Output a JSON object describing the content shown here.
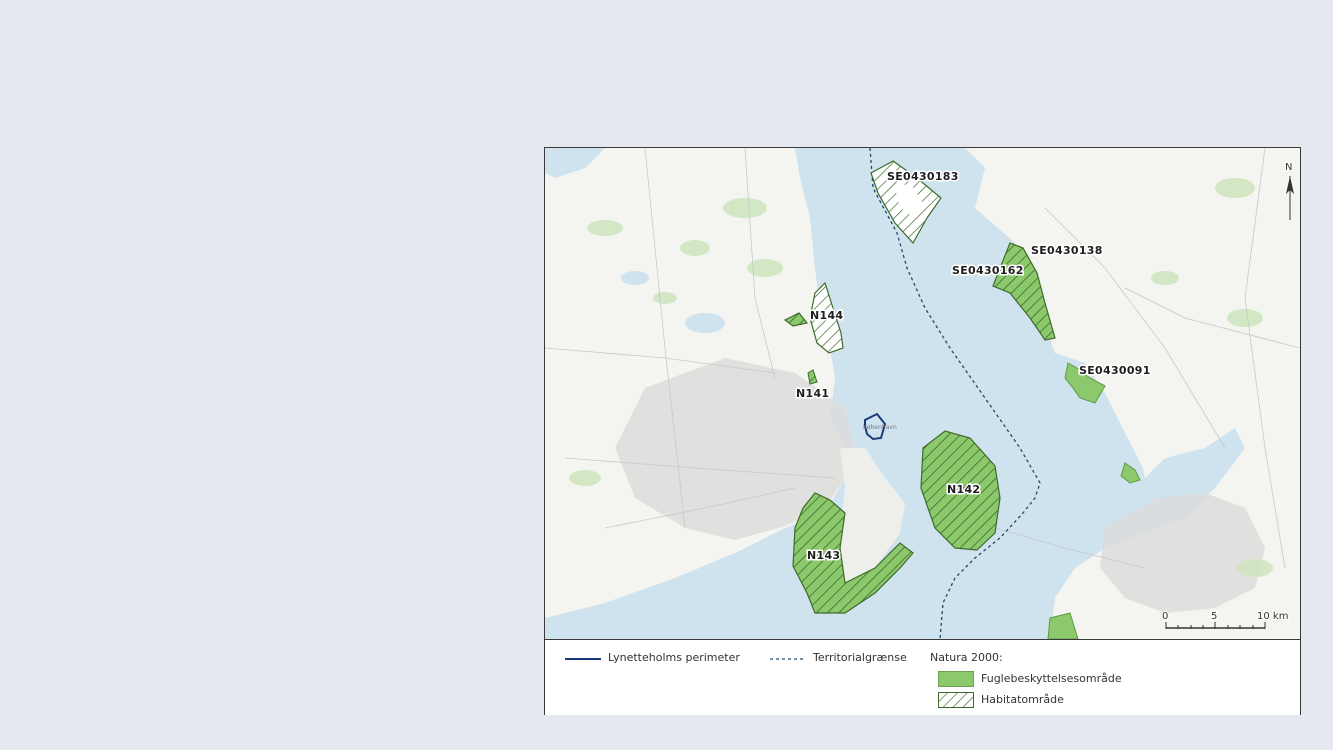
{
  "map": {
    "labels": {
      "se0430183": "SE0430183",
      "se0430138": "SE0430138",
      "se0430162": "SE0430162",
      "n144": "N144",
      "se0430091": "SE0430091",
      "n141": "N141",
      "n142": "N142",
      "n143": "N143"
    },
    "place_label": "København",
    "north_label": "N",
    "scalebar": {
      "ticks": [
        "0",
        "5",
        "10 km"
      ]
    }
  },
  "legend": {
    "perimeter": "Lynetteholms perimeter",
    "territorial": "Territorialgrænse",
    "natura_heading": "Natura 2000:",
    "bird": "Fuglebeskyttelsesområde",
    "habitat": "Habitatområde"
  },
  "colors": {
    "water": "#cfe3ef",
    "land": "#f3f3f0",
    "urban": "#dcdcdc",
    "green_area": "#8cc86c",
    "hatch": "#3d6b2a",
    "perimeter_line": "#1a3a7a",
    "territorial_line": "#1d4a6b"
  }
}
